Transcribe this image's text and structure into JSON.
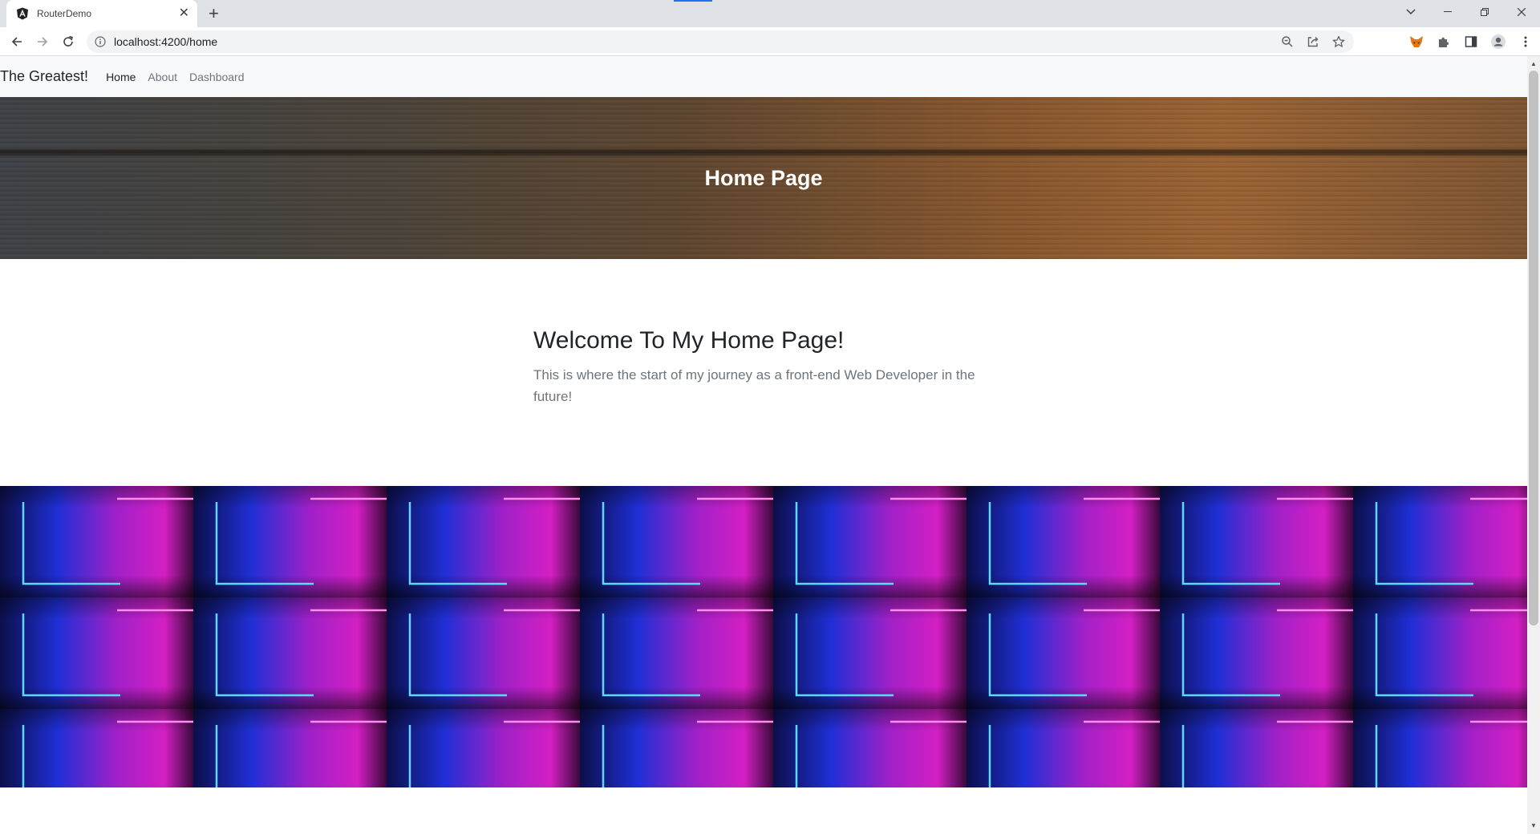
{
  "browser": {
    "tab_title": "RouterDemo",
    "url": "localhost:4200/home",
    "icons": {
      "tab_favicon": "angular-icon",
      "tab_close": "close-icon",
      "new_tab": "plus-icon",
      "back": "arrow-left-icon",
      "forward": "arrow-right-icon",
      "reload": "reload-icon",
      "site_info": "info-icon",
      "zoom": "zoom-icon",
      "share": "share-icon",
      "bookmark": "star-icon",
      "metamask": "fox-extension-icon",
      "extensions": "puzzle-icon",
      "side_panel": "side-panel-icon",
      "profile": "profile-icon",
      "menu": "kebab-menu-icon",
      "tab_search": "chevron-down-icon",
      "minimize": "minimize-icon",
      "restore": "restore-icon",
      "close_window": "close-icon"
    }
  },
  "navbar": {
    "brand": "The Greatest!",
    "links": [
      {
        "label": "Home",
        "active": true
      },
      {
        "label": "About",
        "active": false
      },
      {
        "label": "Dashboard",
        "active": false
      }
    ]
  },
  "hero": {
    "title": "Home Page"
  },
  "main": {
    "heading": "Welcome To My Home Page!",
    "lead": "This is where the start of my journey as a front-end Web Developer in the future!"
  },
  "colors": {
    "navbar_bg": "#f8f9fa",
    "heading": "#212529",
    "muted": "#6c757d",
    "neon_blue": "#1f2fd6",
    "neon_pink": "#d41fc4",
    "neon_cyan": "#5fd8ff"
  }
}
